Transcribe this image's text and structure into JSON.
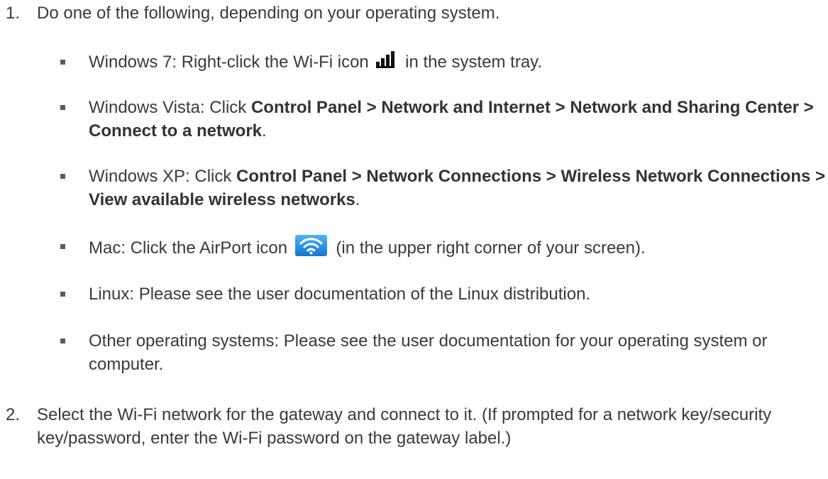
{
  "step1": {
    "number": "1.",
    "text": "Do one of the following, depending on your operating system."
  },
  "bullets": {
    "win7": {
      "before": "Windows 7: Right-click the Wi-Fi icon",
      "after": " in the system tray."
    },
    "vista": {
      "prefix": "Windows Vista: Click ",
      "path": "Control Panel > Network and Internet > Network and Sharing Center > Connect to a network",
      "suffix": "."
    },
    "xp": {
      "prefix": "Windows XP: Click ",
      "path": "Control Panel > Network Connections > Wireless Network Connections > View available wireless networks",
      "suffix": "."
    },
    "mac": {
      "before": "Mac: Click the AirPort icon",
      "after": " (in the upper right corner of your screen)."
    },
    "linux": {
      "text": "Linux: Please see the user documentation of the Linux distribution."
    },
    "other": {
      "text": "Other operating systems: Please see the user documentation for your operating system or computer."
    }
  },
  "step2": {
    "number": "2.",
    "text": "Select the Wi-Fi network for the gateway and connect to it. (If prompted for a network key/security key/password, enter the Wi-Fi password on the gateway label.)"
  },
  "icons": {
    "signal": "wifi-signal-bars-icon",
    "airport": "airport-wifi-icon"
  },
  "colors": {
    "text": "#3a3a3a",
    "airport_blue": "#1e8fe6"
  }
}
